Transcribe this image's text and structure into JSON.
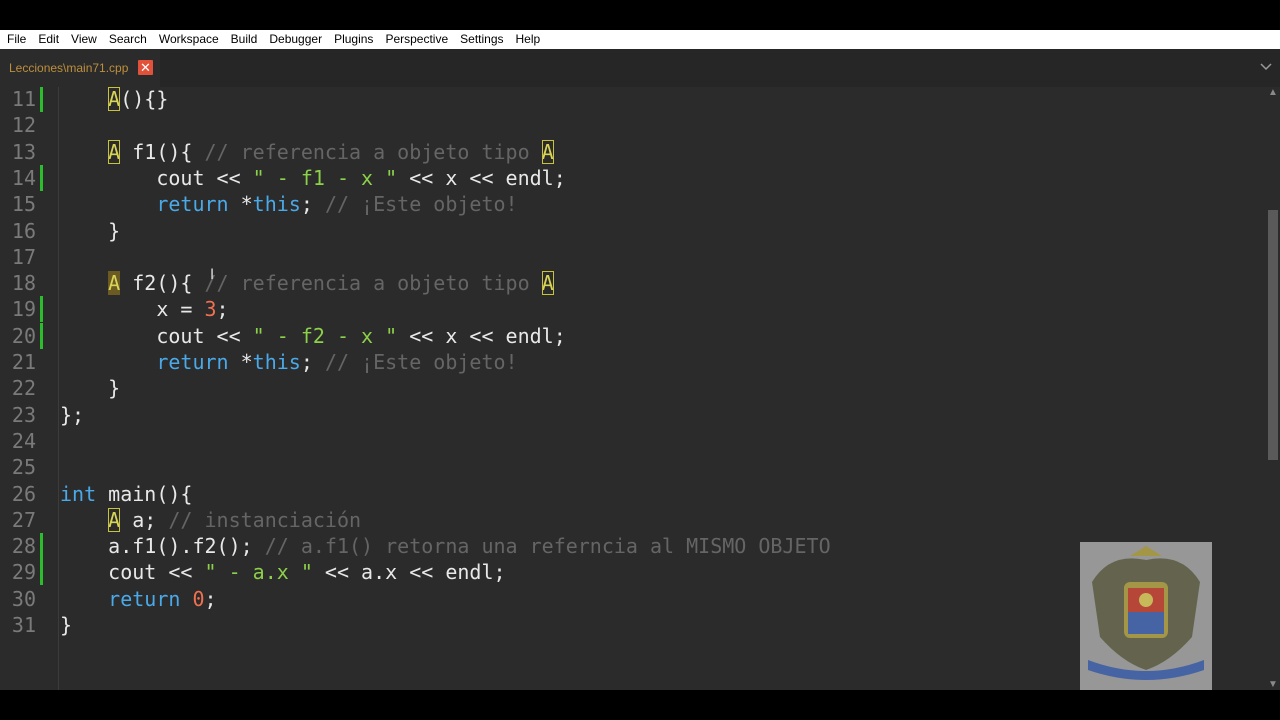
{
  "menu": [
    "File",
    "Edit",
    "View",
    "Search",
    "Workspace",
    "Build",
    "Debugger",
    "Plugins",
    "Perspective",
    "Settings",
    "Help"
  ],
  "tab": {
    "title": "Lecciones\\main71.cpp",
    "close": "✕"
  },
  "icons": {
    "tabs_menu": "chevron-down-icon",
    "tab_close": "close-icon",
    "scroll_up": "triangle-up-icon",
    "scroll_down": "triangle-down-icon"
  },
  "colors": {
    "keyword": "#4aa9e8",
    "string": "#8bd14a",
    "number": "#f07050",
    "comment": "#656565",
    "class_name": "#d8d458",
    "modified_marker": "#2bbd2b",
    "tab_close": "#e2523a",
    "tab_title": "#bd8f3c"
  },
  "editor": {
    "lines": [
      {
        "n": "11",
        "mod": true,
        "tokens": [
          [
            "p",
            "    "
          ],
          [
            "cls",
            "A"
          ],
          [
            "p",
            "(){}"
          ]
        ]
      },
      {
        "n": "12",
        "mod": false,
        "tokens": []
      },
      {
        "n": "13",
        "mod": false,
        "tokens": [
          [
            "p",
            "    "
          ],
          [
            "cls",
            "A"
          ],
          [
            "p",
            " f1(){ "
          ],
          [
            "com",
            "// referencia a objeto tipo "
          ],
          [
            "cls",
            "A"
          ]
        ]
      },
      {
        "n": "14",
        "mod": true,
        "tokens": [
          [
            "p",
            "        cout << "
          ],
          [
            "str",
            "\" - f1 - x \""
          ],
          [
            "p",
            " << x << endl;"
          ]
        ]
      },
      {
        "n": "15",
        "mod": false,
        "tokens": [
          [
            "p",
            "        "
          ],
          [
            "kw",
            "return"
          ],
          [
            "p",
            " *"
          ],
          [
            "kw",
            "this"
          ],
          [
            "p",
            "; "
          ],
          [
            "com",
            "// ¡Este objeto!"
          ]
        ]
      },
      {
        "n": "16",
        "mod": false,
        "tokens": [
          [
            "p",
            "    }"
          ]
        ]
      },
      {
        "n": "17",
        "mod": false,
        "tokens": []
      },
      {
        "n": "18",
        "mod": false,
        "tokens": [
          [
            "p",
            "    "
          ],
          [
            "clssel",
            "A"
          ],
          [
            "p",
            " f2(){ "
          ],
          [
            "com",
            "// referencia a objeto tipo "
          ],
          [
            "cls",
            "A"
          ]
        ]
      },
      {
        "n": "19",
        "mod": true,
        "tokens": [
          [
            "p",
            "        x = "
          ],
          [
            "num",
            "3"
          ],
          [
            "p",
            ";"
          ]
        ]
      },
      {
        "n": "20",
        "mod": true,
        "tokens": [
          [
            "p",
            "        cout << "
          ],
          [
            "str",
            "\" - f2 - x \""
          ],
          [
            "p",
            " << x << endl;"
          ]
        ]
      },
      {
        "n": "21",
        "mod": false,
        "tokens": [
          [
            "p",
            "        "
          ],
          [
            "kw",
            "return"
          ],
          [
            "p",
            " *"
          ],
          [
            "kw",
            "this"
          ],
          [
            "p",
            "; "
          ],
          [
            "com",
            "// ¡Este objeto!"
          ]
        ]
      },
      {
        "n": "22",
        "mod": false,
        "tokens": [
          [
            "p",
            "    }"
          ]
        ]
      },
      {
        "n": "23",
        "mod": false,
        "tokens": [
          [
            "p",
            "};"
          ]
        ]
      },
      {
        "n": "24",
        "mod": false,
        "tokens": []
      },
      {
        "n": "25",
        "mod": false,
        "tokens": []
      },
      {
        "n": "26",
        "mod": false,
        "tokens": [
          [
            "kw",
            "int"
          ],
          [
            "p",
            " main(){"
          ]
        ]
      },
      {
        "n": "27",
        "mod": false,
        "tokens": [
          [
            "p",
            "    "
          ],
          [
            "cls",
            "A"
          ],
          [
            "p",
            " a; "
          ],
          [
            "com",
            "// instanciación"
          ]
        ]
      },
      {
        "n": "28",
        "mod": true,
        "tokens": [
          [
            "p",
            "    a.f1().f2(); "
          ],
          [
            "com",
            "// a.f1() retorna una referncia al MISMO OBJETO"
          ]
        ]
      },
      {
        "n": "29",
        "mod": true,
        "tokens": [
          [
            "p",
            "    cout << "
          ],
          [
            "str",
            "\" - a.x \""
          ],
          [
            "p",
            " << a.x << endl;"
          ]
        ]
      },
      {
        "n": "30",
        "mod": false,
        "tokens": [
          [
            "p",
            "    "
          ],
          [
            "kw",
            "return"
          ],
          [
            "p",
            " "
          ],
          [
            "num",
            "0"
          ],
          [
            "p",
            ";"
          ]
        ]
      },
      {
        "n": "31",
        "mod": false,
        "tokens": [
          [
            "p",
            "}"
          ]
        ]
      }
    ]
  }
}
